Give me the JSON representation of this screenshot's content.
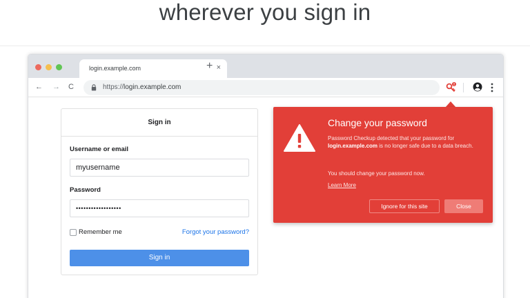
{
  "headline": "wherever you sign in",
  "browser": {
    "tab_title": "login.example.com",
    "tab_close": "×",
    "new_tab": "+",
    "nav_back": "←",
    "nav_forward": "→",
    "nav_reload": "C",
    "url_scheme": "https://",
    "url_host": "login.example.com"
  },
  "signin": {
    "title": "Sign in",
    "username_label": "Username or email",
    "username_value": "myusername",
    "password_label": "Password",
    "password_value": "••••••••••••••••••",
    "remember_label": "Remember me",
    "forgot_link": "Forgot your password?",
    "submit_label": "Sign in"
  },
  "popup": {
    "title": "Change your password",
    "body_prefix": "Password Checkup detected that your password for ",
    "body_site": "login.example.com",
    "body_suffix": " is no longer safe due to a data breach.",
    "body2": "You should change your password now.",
    "learn_more": "Learn More",
    "ignore_label": "Ignore for this site",
    "close_label": "Close"
  },
  "colors": {
    "alert_red": "#e23f38",
    "sign_in_blue": "#4d90e8",
    "link_blue": "#1a73e8"
  },
  "icons": [
    "lock-icon",
    "key-alert-icon",
    "account-icon",
    "menu-icon",
    "warning-icon"
  ]
}
